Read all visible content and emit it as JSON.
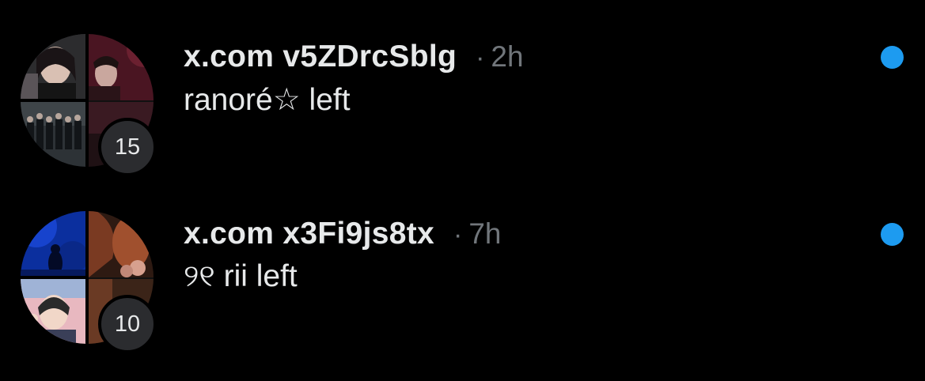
{
  "colors": {
    "background": "#000000",
    "primary_text": "#e7e9ea",
    "secondary_text": "#71767b",
    "unread_dot": "#1d9bf0",
    "badge_bg": "#2b2c2f"
  },
  "conversations": [
    {
      "title": "x.com v5ZDrcSblg",
      "separator": "·",
      "time": "2h",
      "preview": "ranoré☆ left",
      "member_count": "15",
      "unread": true,
      "avatar_icon": "group-avatar-icon"
    },
    {
      "title": "x.com x3Fi9js8tx",
      "separator": "·",
      "time": "7h",
      "preview": "୨୧ rii left",
      "member_count": "10",
      "unread": true,
      "avatar_icon": "group-avatar-icon"
    }
  ]
}
